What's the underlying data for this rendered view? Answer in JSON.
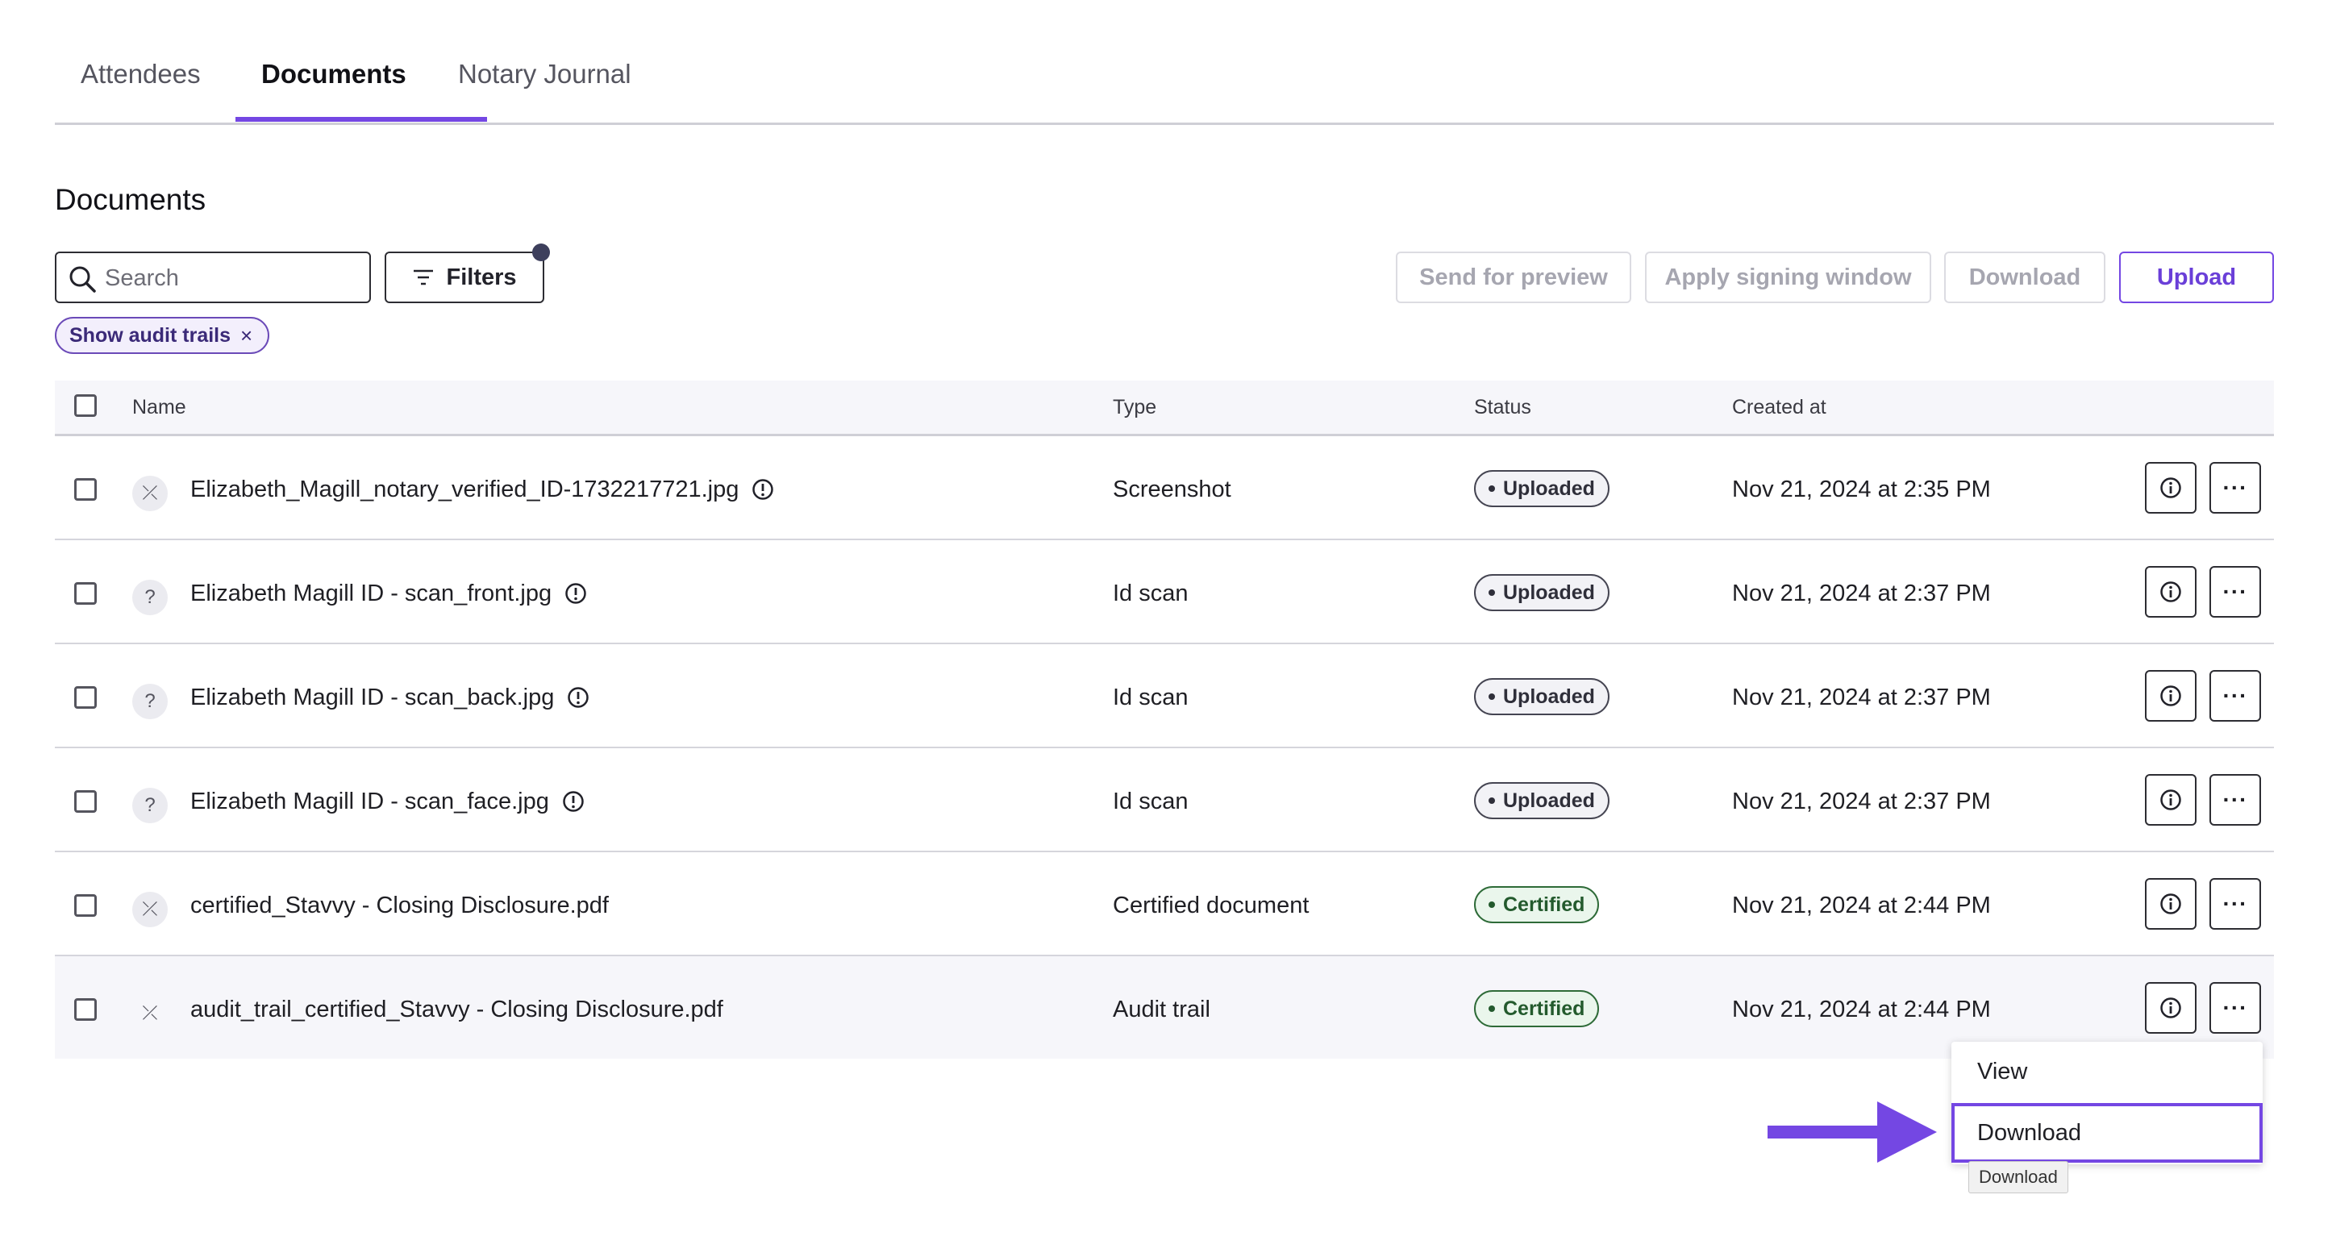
{
  "tabs": [
    {
      "label": "Attendees"
    },
    {
      "label": "Documents"
    },
    {
      "label": "Notary Journal"
    }
  ],
  "active_tab": "Documents",
  "section_title": "Documents",
  "search": {
    "placeholder": "Search",
    "value": ""
  },
  "filters": {
    "label": "Filters"
  },
  "filter_chip": {
    "label": "Show audit trails",
    "remove": "×"
  },
  "toolbar": {
    "send_preview": "Send for preview",
    "apply_signing": "Apply signing window",
    "download": "Download",
    "upload": "Upload"
  },
  "table": {
    "headers": {
      "name": "Name",
      "type": "Type",
      "status": "Status",
      "created": "Created at"
    },
    "rows": [
      {
        "icon": "crossed-out-icon",
        "icon_glyph": "⤫",
        "name": "Elizabeth_Magill_notary_verified_ID-1732217721.jpg",
        "warning": true,
        "type": "Screenshot",
        "status": "Uploaded",
        "created": "Nov 21, 2024 at 2:35 PM"
      },
      {
        "icon": "question-icon",
        "icon_glyph": "?",
        "name": "Elizabeth Magill ID - scan_front.jpg",
        "warning": true,
        "type": "Id scan",
        "status": "Uploaded",
        "created": "Nov 21, 2024 at 2:37 PM"
      },
      {
        "icon": "question-icon",
        "icon_glyph": "?",
        "name": "Elizabeth Magill ID - scan_back.jpg",
        "warning": true,
        "type": "Id scan",
        "status": "Uploaded",
        "created": "Nov 21, 2024 at 2:37 PM"
      },
      {
        "icon": "question-icon",
        "icon_glyph": "?",
        "name": "Elizabeth Magill ID - scan_face.jpg",
        "warning": true,
        "type": "Id scan",
        "status": "Uploaded",
        "created": "Nov 21, 2024 at 2:37 PM"
      },
      {
        "icon": "crossed-out-icon",
        "icon_glyph": "⤫",
        "name": "certified_Stavvy - Closing Disclosure.pdf",
        "warning": false,
        "type": "Certified document",
        "status": "Certified",
        "created": "Nov 21, 2024 at 2:44 PM"
      },
      {
        "icon": "crossed-out-icon",
        "icon_glyph": "⤫",
        "name": "audit_trail_certified_Stavvy - Closing Disclosure.pdf",
        "warning": false,
        "type": "Audit trail",
        "status": "Certified",
        "created": "Nov 21, 2024 at 2:44 PM"
      }
    ]
  },
  "row_actions": {
    "more_glyph": "···"
  },
  "context_menu": {
    "items": [
      "View",
      "Download"
    ],
    "focused": "Download"
  },
  "tooltip": "Download",
  "colors": {
    "accent": "#7447e3",
    "certified": "#235a2d",
    "uploaded": "#2f2f3a"
  }
}
